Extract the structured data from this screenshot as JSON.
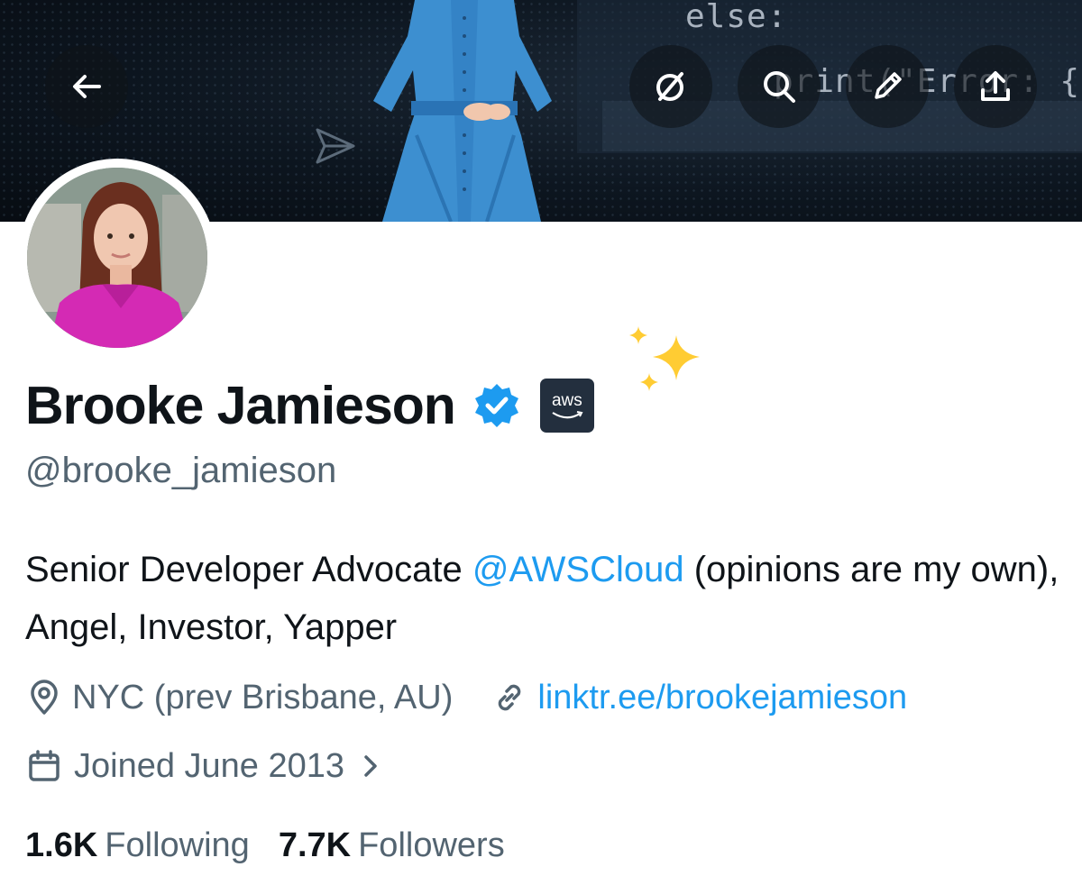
{
  "header": {
    "buttons": {
      "back": "arrow-left-icon",
      "grok": "grok-icon",
      "search": "search-icon",
      "edit": "pencil-icon",
      "share": "share-icon"
    },
    "banner_code": {
      "line1": "else:",
      "line2": "print(\"Error: {"
    }
  },
  "profile": {
    "name": "Brooke Jamieson",
    "handle": "@brooke_jamieson",
    "bio_prefix": "Senior Developer Advocate ",
    "bio_mention": "@AWSCloud",
    "bio_suffix": " (opinions are my own), Angel, Investor, Yapper",
    "affiliate_badge_text": "aws",
    "location": "NYC (prev Brisbane, AU)",
    "website": "linktr.ee/brookejamieson",
    "joined": "Joined June 2013",
    "following_count": "1.6K",
    "following_label": "Following",
    "followers_count": "7.7K",
    "followers_label": "Followers"
  },
  "colors": {
    "accent": "#1d9bf0",
    "text_primary": "#0f1419",
    "text_secondary": "#536471",
    "verified": "#1d9bf0",
    "aws_badge_bg": "#232f3e",
    "aws_smile": "#ff9900"
  }
}
